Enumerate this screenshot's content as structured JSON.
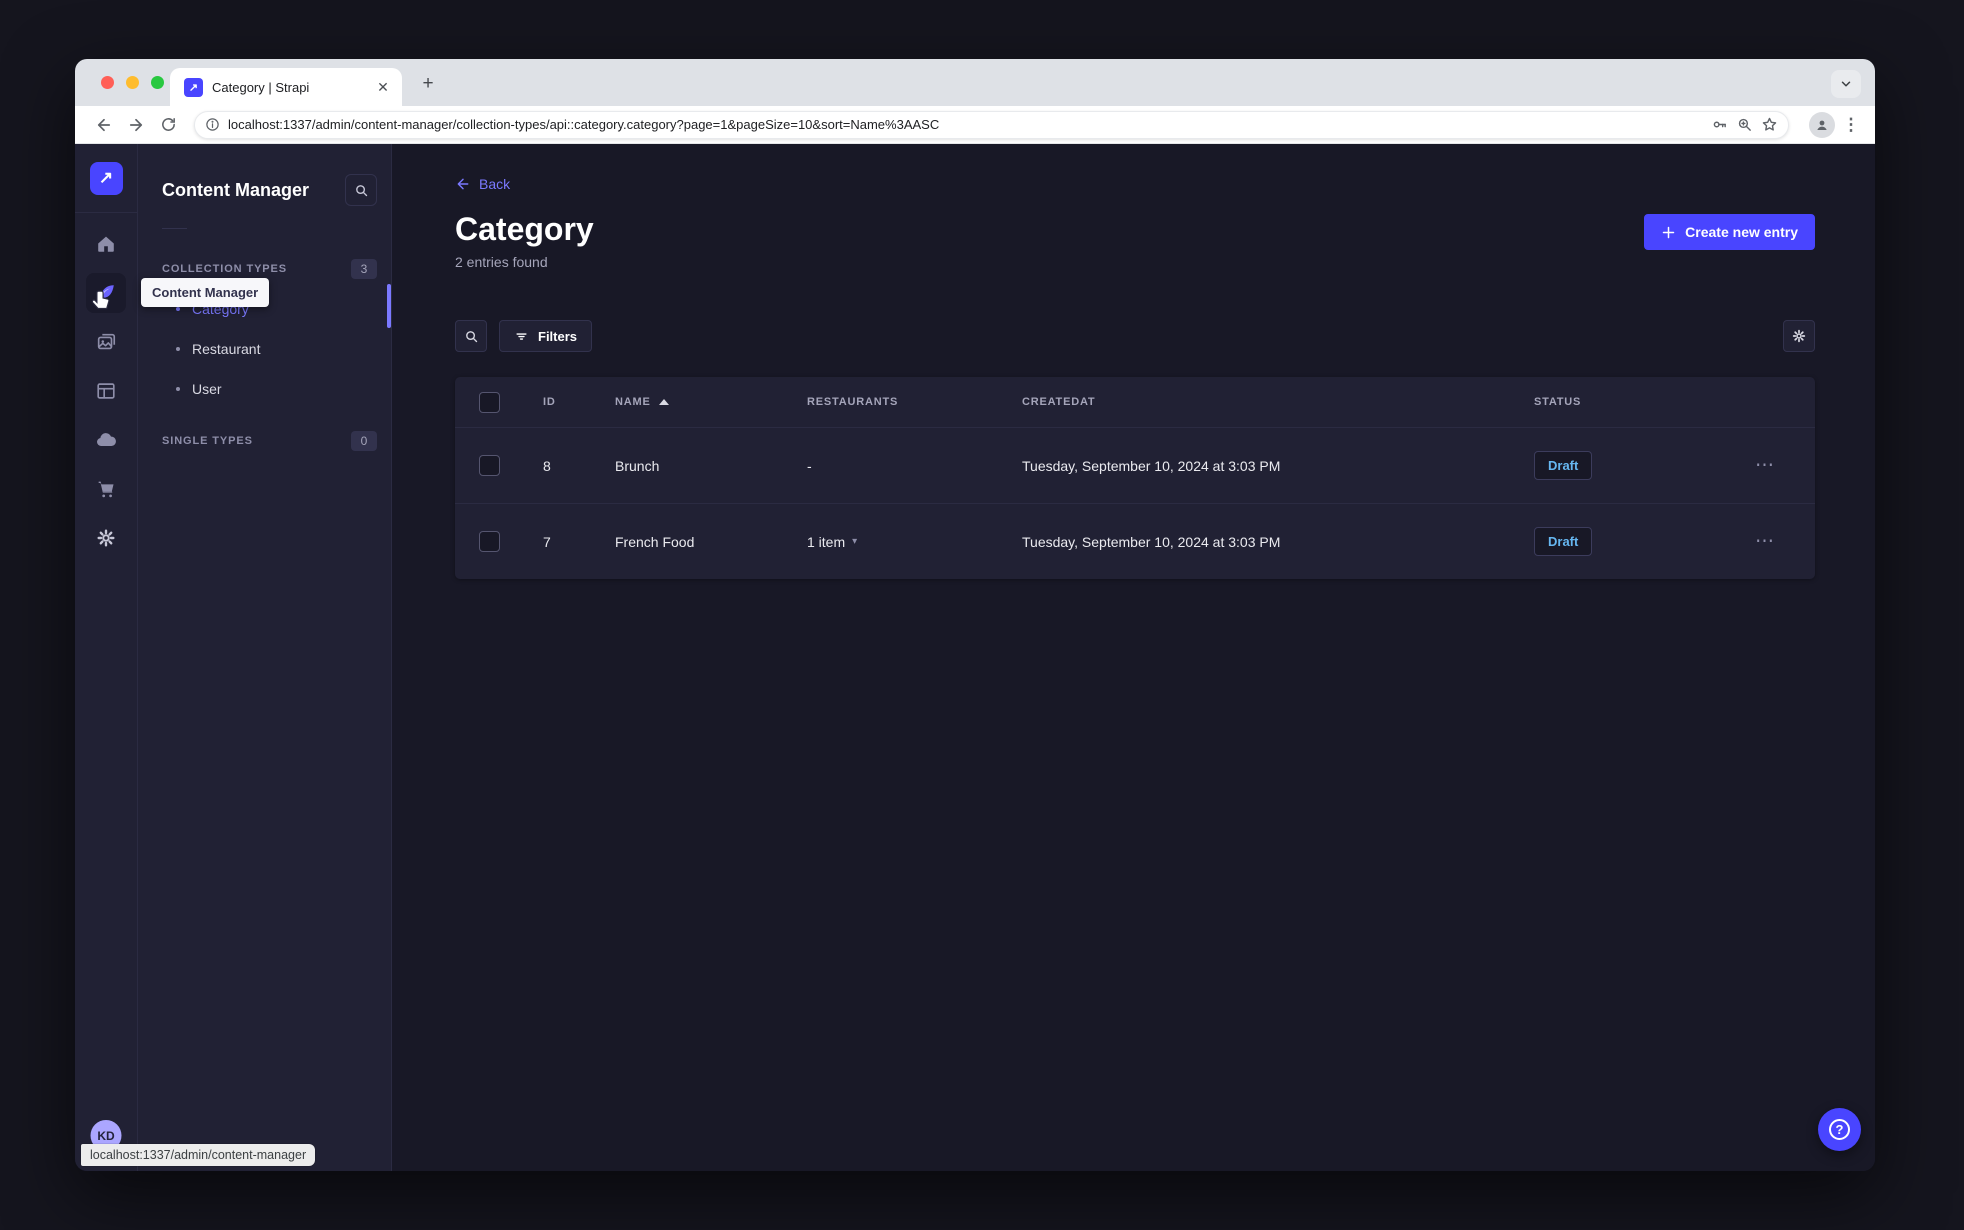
{
  "browser": {
    "tab_title": "Category | Strapi",
    "new_tab_label": "+",
    "url": "localhost:1337/admin/content-manager/collection-types/api::category.category?page=1&pageSize=10&sort=Name%3AASC",
    "status_bar": "localhost:1337/admin/content-manager"
  },
  "sidebar": {
    "icons": [
      "home",
      "content-manager",
      "media-library",
      "content-type-builder",
      "cloud",
      "marketplace",
      "settings"
    ],
    "user_initials": "KD"
  },
  "subnav": {
    "title": "Content Manager",
    "tooltip": "Content Manager",
    "sections": [
      {
        "label": "COLLECTION TYPES",
        "badge": "3",
        "items": [
          {
            "label": "Category",
            "active": true
          },
          {
            "label": "Restaurant",
            "active": false
          },
          {
            "label": "User",
            "active": false
          }
        ]
      },
      {
        "label": "SINGLE TYPES",
        "badge": "0",
        "items": []
      }
    ]
  },
  "main": {
    "back_label": "Back",
    "title": "Category",
    "entries_found": "2 entries found",
    "create_button_label": "Create new entry",
    "filters_label": "Filters",
    "table": {
      "columns": [
        "ID",
        "NAME",
        "RESTAURANTS",
        "CREATEDAT",
        "STATUS"
      ],
      "rows": [
        {
          "id": "8",
          "name": "Brunch",
          "restaurants": "-",
          "createdAt": "Tuesday, September 10, 2024 at 3:03 PM",
          "status": "Draft"
        },
        {
          "id": "7",
          "name": "French Food",
          "restaurants": "1 item",
          "createdAt": "Tuesday, September 10, 2024 at 3:03 PM",
          "status": "Draft"
        }
      ]
    }
  },
  "colors": {
    "accent": "#4945ff",
    "link": "#7b79ff",
    "draft_status": "#66b7f1",
    "panel": "#212134",
    "background": "#181826",
    "border": "#32324d"
  }
}
